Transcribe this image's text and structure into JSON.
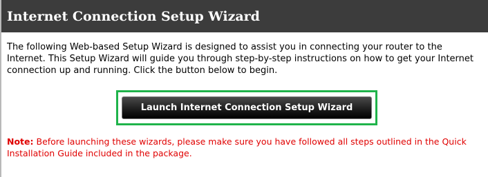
{
  "header": {
    "title": "Internet Connection Setup Wizard"
  },
  "intro": {
    "text": "The following Web-based Setup Wizard is designed to assist you in connecting your router to the Internet. This Setup Wizard will guide you through step-by-step instructions on how to get your Internet connection up and running. Click the button below to begin."
  },
  "launch_button": {
    "label": "Launch Internet Connection Setup Wizard"
  },
  "note": {
    "label": "Note:",
    "text": " Before launching these wizards, please make sure you have followed all steps outlined in the Quick Installation Guide included in the package."
  },
  "colors": {
    "header_bg": "#3c3c3c",
    "highlight_frame": "#1fb34a",
    "note_text": "#e00000"
  }
}
